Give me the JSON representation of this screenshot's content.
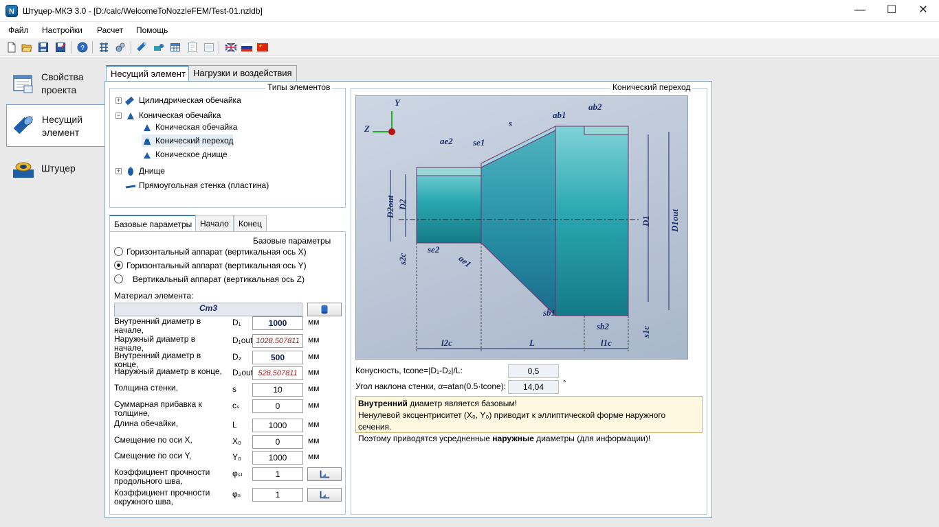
{
  "window": {
    "title": "Штуцер-МКЭ 3.0 - [D:/calc/WelcomeToNozzleFEM/Test-01.nzldb]",
    "app_icon_letter": "N"
  },
  "menu": [
    "Файл",
    "Настройки",
    "Расчет",
    "Помощь"
  ],
  "sidebar": {
    "items": [
      {
        "label_line1": "Свойства",
        "label_line2": "проекта"
      },
      {
        "label_line1": "Несущий",
        "label_line2": "элемент"
      },
      {
        "label_line1": "Штуцер",
        "label_line2": ""
      }
    ]
  },
  "tabs": [
    "Несущий элемент",
    "Нагрузки и воздействия"
  ],
  "element_types": {
    "title": "Типы элементов",
    "items": [
      {
        "label": "Цилиндрическая обечайка",
        "level": 0,
        "expander": "+"
      },
      {
        "label": "Коническая обечайка",
        "level": 0,
        "expander": "−"
      },
      {
        "label": "Коническая обечайка",
        "level": 1
      },
      {
        "label": "Конический переход",
        "level": 1,
        "selected": true
      },
      {
        "label": "Коническое днище",
        "level": 1
      },
      {
        "label": "Днище",
        "level": 0,
        "expander": "+"
      },
      {
        "label": "Прямоугольная стенка (пластина)",
        "level": 0
      }
    ]
  },
  "subtabs": [
    "Базовые параметры",
    "Начало",
    "Конец"
  ],
  "base_params": {
    "title": "Базовые параметры",
    "radios": [
      {
        "label": "Горизонтальный аппарат (вертикальная ось X)",
        "checked": false
      },
      {
        "label": "Горизонтальный аппарат (вертикальная ось Y)",
        "checked": true
      },
      {
        "label": "Вертикальный аппарат (вертикальная ось Z)",
        "checked": false
      }
    ],
    "material_label": "Материал элемента:",
    "material_value": "Ст3",
    "params": [
      {
        "label": "Внутренний диаметр в начале,",
        "sym": "D₁",
        "value": "1000",
        "unit": "мм",
        "style": "bold"
      },
      {
        "label": "Наружный диаметр в начале,",
        "sym": "D₁out",
        "value": "1028.507811",
        "unit": "мм",
        "style": "calc"
      },
      {
        "label": "Внутренний диаметр в конце,",
        "sym": "D₂",
        "value": "500",
        "unit": "мм",
        "style": "bold"
      },
      {
        "label": "Наружный диаметр в конце,",
        "sym": "D₂out",
        "value": "528.507811",
        "unit": "мм",
        "style": "calc"
      },
      {
        "label": "Толщина стенки,",
        "sym": "s",
        "value": "10",
        "unit": "мм",
        "style": ""
      },
      {
        "label": "Суммарная прибавка к толщине,",
        "sym": "cₛ",
        "value": "0",
        "unit": "мм",
        "style": ""
      },
      {
        "label": "Длина обечайки,",
        "sym": "L",
        "value": "1000",
        "unit": "мм",
        "style": ""
      },
      {
        "label": "Смещение по оси X,",
        "sym": "X₀",
        "value": "0",
        "unit": "мм",
        "style": ""
      },
      {
        "label": "Смещение по оси Y,",
        "sym": "Y₀",
        "value": "1000",
        "unit": "мм",
        "style": ""
      },
      {
        "label": "Коэффициент прочности продольного шва,",
        "sym": "φₛₗ",
        "value": "1",
        "unit": "",
        "style": ""
      },
      {
        "label": "Коэффициент прочности окружного шва,",
        "sym": "φₛ",
        "value": "1",
        "unit": "",
        "style": ""
      }
    ]
  },
  "conic": {
    "title": "Конический переход",
    "conicity_label": "Конусность, tcone=|D₁-D₂|/L:",
    "conicity_value": "0,5",
    "angle_label": "Угол наклона стенки, α=atan(0.5·tcone):",
    "angle_value": "14,04",
    "angle_unit": "°",
    "note": {
      "line1_bold": "Внутренний",
      "line1_rest": " диаметр является базовым!",
      "line2": "Ненулевой эксцентриситет (X₀, Y₀) приводит к эллиптической форме наружного сечения.",
      "line3_a": "Поэтому приводятся усредненные ",
      "line3_bold": "наружные",
      "line3_b": " диаметры (для информации)!"
    },
    "diagram_labels": {
      "D2out": "D2out",
      "D2": "D2",
      "D1": "D1",
      "D1out": "D1out",
      "ae2": "ae2",
      "se1": "se1",
      "s": "s",
      "ab1": "ab1",
      "ab2": "ab2",
      "se2": "se2",
      "ae1": "ae1",
      "s2c": "s2c",
      "sb1": "sb1",
      "sb2": "sb2",
      "s1c": "s1c",
      "l2c": "l2c",
      "L": "L",
      "l1c": "l1c",
      "axis_y": "Y",
      "axis_z": "Z"
    }
  }
}
